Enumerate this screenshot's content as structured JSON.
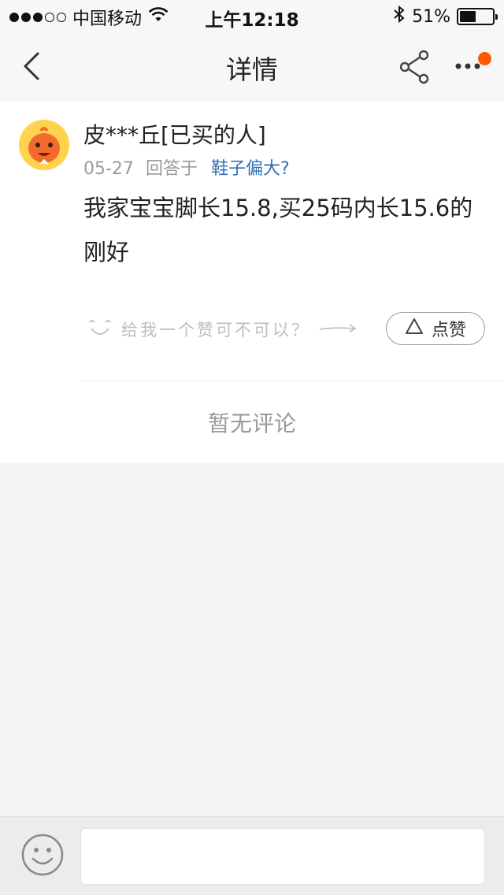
{
  "status_bar": {
    "carrier": "中国移动",
    "time": "上午12:18",
    "battery_percent": "51%",
    "battery_level": 0.51,
    "signal_filled": 3,
    "signal_total": 5
  },
  "nav": {
    "title": "详情",
    "back_icon": "chevron-left-icon",
    "share_icon": "share-icon",
    "more_icon": "more-dots-icon",
    "badge_color": "#ff5a00"
  },
  "post": {
    "username": "皮***丘[已买的人]",
    "date": "05-27",
    "reply_prefix": "回答于",
    "question": "鞋子偏大?",
    "answer": "我家宝宝脚长15.8,买25码内长15.6的刚好",
    "like_hint": "给我一个赞可不可以？",
    "like_label": "点赞",
    "link_color": "#2f6fb8"
  },
  "comments": {
    "empty_text": "暂无评论"
  },
  "bottom": {
    "emoji_icon": "smiley-icon",
    "input_value": "",
    "input_placeholder": ""
  }
}
